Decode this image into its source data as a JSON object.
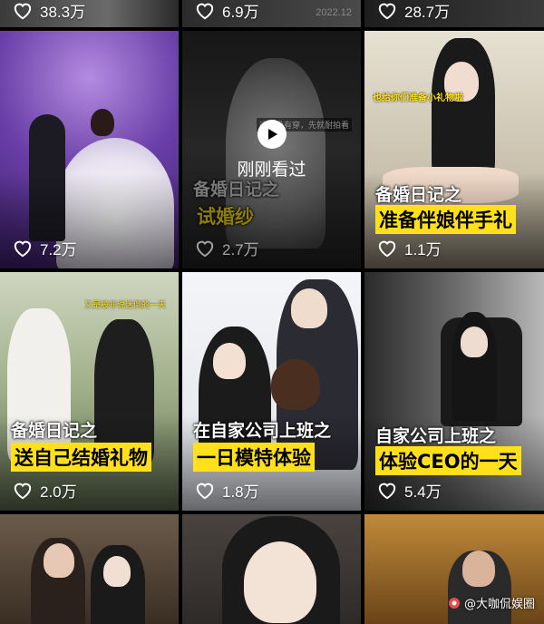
{
  "grid": {
    "tiles": [
      {
        "likes": "38.3万"
      },
      {
        "likes": "6.9万",
        "date_mark": "2022.12"
      },
      {
        "likes": "28.7万"
      },
      {
        "likes": "7.2万"
      },
      {
        "likes": "2.7万",
        "caption_top": "备婚日记之",
        "caption_bottom": "试婚纱",
        "overlay_note": "这个没有穿，先就耐拍看",
        "watched_label": "刚刚看过"
      },
      {
        "likes": "1.1万",
        "caption_top": "备婚日记之",
        "caption_bottom": "准备伴娘伴手礼",
        "overlay_note": "也给你们准备小礼物啦"
      },
      {
        "likes": "2.0万",
        "caption_top": "备婚日记之",
        "caption_bottom": "送自己结婚礼物",
        "overlay_note": "又是被非说迷倒的一天"
      },
      {
        "likes": "1.8万",
        "caption_top": "在自家公司上班之",
        "caption_bottom": "一日模特体验"
      },
      {
        "likes": "5.4万",
        "caption_top": "自家公司上班之",
        "caption_bottom": "体验CEO的一天"
      },
      {},
      {},
      {}
    ]
  },
  "watermark": "@大咖侃娱圈",
  "colors": {
    "caption_yellow": "#ffe01a",
    "bg": "#000000"
  }
}
